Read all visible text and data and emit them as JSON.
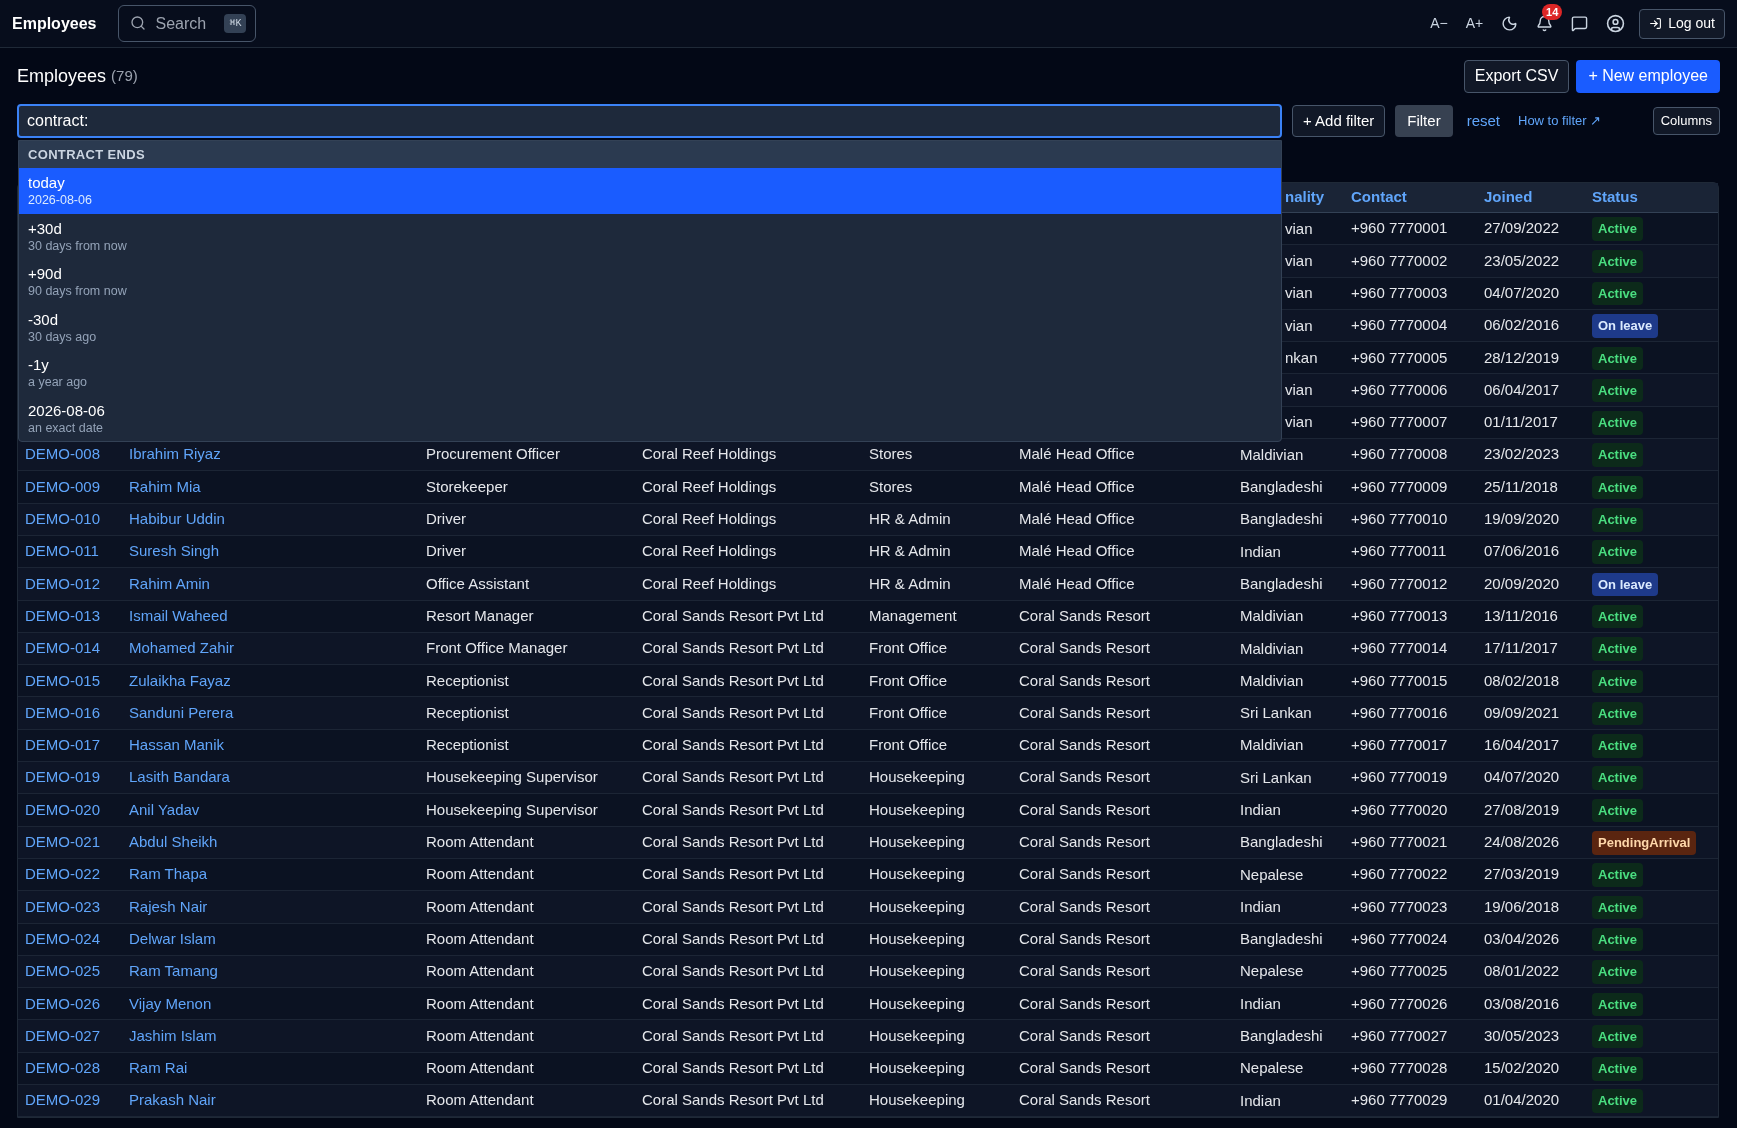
{
  "topbar": {
    "title": "Employees",
    "search": {
      "placeholder": "Search",
      "shortcut": "⌘K"
    },
    "font_smaller": "A−",
    "font_larger": "A+",
    "notifications": "14",
    "logout": "Log out"
  },
  "header": {
    "title": "Employees",
    "count": "(79)",
    "export": "Export CSV",
    "new": "+ New employee"
  },
  "filter": {
    "value": "contract:",
    "add_filter": "+ Add filter",
    "filter": "Filter",
    "reset": "reset",
    "help": "How to filter ↗",
    "columns": "Columns"
  },
  "dropdown": {
    "heading": "CONTRACT ENDS",
    "options": [
      {
        "label": "today",
        "hint": "2026-08-06",
        "selected": true
      },
      {
        "label": "+30d",
        "hint": "30 days from now",
        "selected": false
      },
      {
        "label": "+90d",
        "hint": "90 days from now",
        "selected": false
      },
      {
        "label": "-30d",
        "hint": "30 days ago",
        "selected": false
      },
      {
        "label": "-1y",
        "hint": "a year ago",
        "selected": false
      },
      {
        "label": "2026-08-06",
        "hint": "an exact date",
        "selected": false
      }
    ]
  },
  "table": {
    "columns": [
      "nality",
      "Contact",
      "Joined",
      "Status"
    ],
    "rows": [
      {
        "nationality": "vian",
        "contact": "+960 7770001",
        "joined": "27/09/2022",
        "status": {
          "label": "Active",
          "kind": "active"
        }
      },
      {
        "nationality": "vian",
        "contact": "+960 7770002",
        "joined": "23/05/2022",
        "status": {
          "label": "Active",
          "kind": "active"
        }
      },
      {
        "nationality": "vian",
        "contact": "+960 7770003",
        "joined": "04/07/2020",
        "status": {
          "label": "Active",
          "kind": "active"
        }
      },
      {
        "nationality": "vian",
        "contact": "+960 7770004",
        "joined": "06/02/2016",
        "status": {
          "label": "On leave",
          "kind": "leave"
        }
      },
      {
        "nationality": "nkan",
        "contact": "+960 7770005",
        "joined": "28/12/2019",
        "status": {
          "label": "Active",
          "kind": "active"
        }
      },
      {
        "nationality": "vian",
        "contact": "+960 7770006",
        "joined": "06/04/2017",
        "status": {
          "label": "Active",
          "kind": "active"
        }
      },
      {
        "nationality": "vian",
        "contact": "+960 7770007",
        "joined": "01/11/2017",
        "status": {
          "label": "Active",
          "kind": "active"
        }
      },
      {
        "id": "DEMO-008",
        "name": "Ibrahim Riyaz",
        "position": "Procurement Officer",
        "company": "Coral Reef Holdings",
        "department": "Stores",
        "location": "Malé Head Office",
        "nationality": "Maldivian",
        "contact": "+960 7770008",
        "joined": "23/02/2023",
        "status": {
          "label": "Active",
          "kind": "active"
        }
      },
      {
        "id": "DEMO-009",
        "name": "Rahim Mia",
        "position": "Storekeeper",
        "company": "Coral Reef Holdings",
        "department": "Stores",
        "location": "Malé Head Office",
        "nationality": "Bangladeshi",
        "contact": "+960 7770009",
        "joined": "25/11/2018",
        "status": {
          "label": "Active",
          "kind": "active"
        }
      },
      {
        "id": "DEMO-010",
        "name": "Habibur Uddin",
        "position": "Driver",
        "company": "Coral Reef Holdings",
        "department": "HR & Admin",
        "location": "Malé Head Office",
        "nationality": "Bangladeshi",
        "contact": "+960 7770010",
        "joined": "19/09/2020",
        "status": {
          "label": "Active",
          "kind": "active"
        }
      },
      {
        "id": "DEMO-011",
        "name": "Suresh Singh",
        "position": "Driver",
        "company": "Coral Reef Holdings",
        "department": "HR & Admin",
        "location": "Malé Head Office",
        "nationality": "Indian",
        "contact": "+960 7770011",
        "joined": "07/06/2016",
        "status": {
          "label": "Active",
          "kind": "active"
        }
      },
      {
        "id": "DEMO-012",
        "name": "Rahim Amin",
        "position": "Office Assistant",
        "company": "Coral Reef Holdings",
        "department": "HR & Admin",
        "location": "Malé Head Office",
        "nationality": "Bangladeshi",
        "contact": "+960 7770012",
        "joined": "20/09/2020",
        "status": {
          "label": "On leave",
          "kind": "leave"
        }
      },
      {
        "id": "DEMO-013",
        "name": "Ismail Waheed",
        "position": "Resort Manager",
        "company": "Coral Sands Resort Pvt Ltd",
        "department": "Management",
        "location": "Coral Sands Resort",
        "nationality": "Maldivian",
        "contact": "+960 7770013",
        "joined": "13/11/2016",
        "status": {
          "label": "Active",
          "kind": "active"
        }
      },
      {
        "id": "DEMO-014",
        "name": "Mohamed Zahir",
        "position": "Front Office Manager",
        "company": "Coral Sands Resort Pvt Ltd",
        "department": "Front Office",
        "location": "Coral Sands Resort",
        "nationality": "Maldivian",
        "contact": "+960 7770014",
        "joined": "17/11/2017",
        "status": {
          "label": "Active",
          "kind": "active"
        }
      },
      {
        "id": "DEMO-015",
        "name": "Zulaikha Fayaz",
        "position": "Receptionist",
        "company": "Coral Sands Resort Pvt Ltd",
        "department": "Front Office",
        "location": "Coral Sands Resort",
        "nationality": "Maldivian",
        "contact": "+960 7770015",
        "joined": "08/02/2018",
        "status": {
          "label": "Active",
          "kind": "active"
        }
      },
      {
        "id": "DEMO-016",
        "name": "Sanduni Perera",
        "position": "Receptionist",
        "company": "Coral Sands Resort Pvt Ltd",
        "department": "Front Office",
        "location": "Coral Sands Resort",
        "nationality": "Sri Lankan",
        "contact": "+960 7770016",
        "joined": "09/09/2021",
        "status": {
          "label": "Active",
          "kind": "active"
        }
      },
      {
        "id": "DEMO-017",
        "name": "Hassan Manik",
        "position": "Receptionist",
        "company": "Coral Sands Resort Pvt Ltd",
        "department": "Front Office",
        "location": "Coral Sands Resort",
        "nationality": "Maldivian",
        "contact": "+960 7770017",
        "joined": "16/04/2017",
        "status": {
          "label": "Active",
          "kind": "active"
        }
      },
      {
        "id": "DEMO-019",
        "name": "Lasith Bandara",
        "position": "Housekeeping Supervisor",
        "company": "Coral Sands Resort Pvt Ltd",
        "department": "Housekeeping",
        "location": "Coral Sands Resort",
        "nationality": "Sri Lankan",
        "contact": "+960 7770019",
        "joined": "04/07/2020",
        "status": {
          "label": "Active",
          "kind": "active"
        }
      },
      {
        "id": "DEMO-020",
        "name": "Anil Yadav",
        "position": "Housekeeping Supervisor",
        "company": "Coral Sands Resort Pvt Ltd",
        "department": "Housekeeping",
        "location": "Coral Sands Resort",
        "nationality": "Indian",
        "contact": "+960 7770020",
        "joined": "27/08/2019",
        "status": {
          "label": "Active",
          "kind": "active"
        }
      },
      {
        "id": "DEMO-021",
        "name": "Abdul Sheikh",
        "position": "Room Attendant",
        "company": "Coral Sands Resort Pvt Ltd",
        "department": "Housekeeping",
        "location": "Coral Sands Resort",
        "nationality": "Bangladeshi",
        "contact": "+960 7770021",
        "joined": "24/08/2026",
        "status": {
          "label": "PendingArrival",
          "kind": "pending"
        }
      },
      {
        "id": "DEMO-022",
        "name": "Ram Thapa",
        "position": "Room Attendant",
        "company": "Coral Sands Resort Pvt Ltd",
        "department": "Housekeeping",
        "location": "Coral Sands Resort",
        "nationality": "Nepalese",
        "contact": "+960 7770022",
        "joined": "27/03/2019",
        "status": {
          "label": "Active",
          "kind": "active"
        }
      },
      {
        "id": "DEMO-023",
        "name": "Rajesh Nair",
        "position": "Room Attendant",
        "company": "Coral Sands Resort Pvt Ltd",
        "department": "Housekeeping",
        "location": "Coral Sands Resort",
        "nationality": "Indian",
        "contact": "+960 7770023",
        "joined": "19/06/2018",
        "status": {
          "label": "Active",
          "kind": "active"
        }
      },
      {
        "id": "DEMO-024",
        "name": "Delwar Islam",
        "position": "Room Attendant",
        "company": "Coral Sands Resort Pvt Ltd",
        "department": "Housekeeping",
        "location": "Coral Sands Resort",
        "nationality": "Bangladeshi",
        "contact": "+960 7770024",
        "joined": "03/04/2026",
        "status": {
          "label": "Active",
          "kind": "active"
        }
      },
      {
        "id": "DEMO-025",
        "name": "Ram Tamang",
        "position": "Room Attendant",
        "company": "Coral Sands Resort Pvt Ltd",
        "department": "Housekeeping",
        "location": "Coral Sands Resort",
        "nationality": "Nepalese",
        "contact": "+960 7770025",
        "joined": "08/01/2022",
        "status": {
          "label": "Active",
          "kind": "active"
        }
      },
      {
        "id": "DEMO-026",
        "name": "Vijay Menon",
        "position": "Room Attendant",
        "company": "Coral Sands Resort Pvt Ltd",
        "department": "Housekeeping",
        "location": "Coral Sands Resort",
        "nationality": "Indian",
        "contact": "+960 7770026",
        "joined": "03/08/2016",
        "status": {
          "label": "Active",
          "kind": "active"
        }
      },
      {
        "id": "DEMO-027",
        "name": "Jashim Islam",
        "position": "Room Attendant",
        "company": "Coral Sands Resort Pvt Ltd",
        "department": "Housekeeping",
        "location": "Coral Sands Resort",
        "nationality": "Bangladeshi",
        "contact": "+960 7770027",
        "joined": "30/05/2023",
        "status": {
          "label": "Active",
          "kind": "active"
        }
      },
      {
        "id": "DEMO-028",
        "name": "Ram Rai",
        "position": "Room Attendant",
        "company": "Coral Sands Resort Pvt Ltd",
        "department": "Housekeeping",
        "location": "Coral Sands Resort",
        "nationality": "Nepalese",
        "contact": "+960 7770028",
        "joined": "15/02/2020",
        "status": {
          "label": "Active",
          "kind": "active"
        }
      },
      {
        "id": "DEMO-029",
        "name": "Prakash Nair",
        "position": "Room Attendant",
        "company": "Coral Sands Resort Pvt Ltd",
        "department": "Housekeeping",
        "location": "Coral Sands Resort",
        "nationality": "Indian",
        "contact": "+960 7770029",
        "joined": "01/04/2020",
        "status": {
          "label": "Active",
          "kind": "active"
        }
      }
    ]
  }
}
